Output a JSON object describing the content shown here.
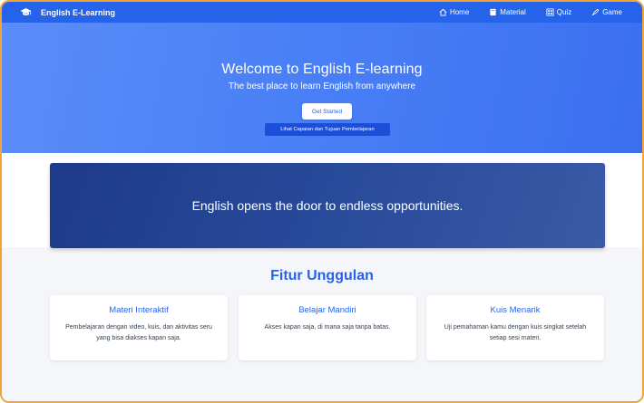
{
  "navbar": {
    "brand": "English E-Learning",
    "brand_icon": "graduation-cap-icon",
    "links": [
      {
        "label": "Home",
        "icon": "home-icon"
      },
      {
        "label": "Material",
        "icon": "book-icon"
      },
      {
        "label": "Quiz",
        "icon": "grid-icon"
      },
      {
        "label": "Game",
        "icon": "rocket-icon"
      }
    ]
  },
  "hero": {
    "title": "Welcome to English E-learning",
    "subtitle": "The best place to learn English from anywhere",
    "start_button": "Get Started",
    "goals_button": "Lihat Capaian dan Tujuan Pembelajaran"
  },
  "banner": {
    "text": "English opens the door to endless opportunities."
  },
  "features": {
    "title": "Fitur Unggulan",
    "cards": [
      {
        "title": "Materi Interaktif",
        "description": "Pembelajaran dengan video, kuis, dan aktivitas seru yang bisa diakses kapan saja."
      },
      {
        "title": "Belajar Mandiri",
        "description": "Akses kapan saja, di mana saja tanpa batas."
      },
      {
        "title": "Kuis Menarik",
        "description": "Uji pemahaman kamu dengan kuis singkat setelah setiap sesi materi."
      }
    ]
  },
  "colors": {
    "primary": "#2563eb",
    "banner": "#1e3a8a",
    "frame_border": "#f0a43a",
    "section_bg": "#f4f6f9"
  }
}
